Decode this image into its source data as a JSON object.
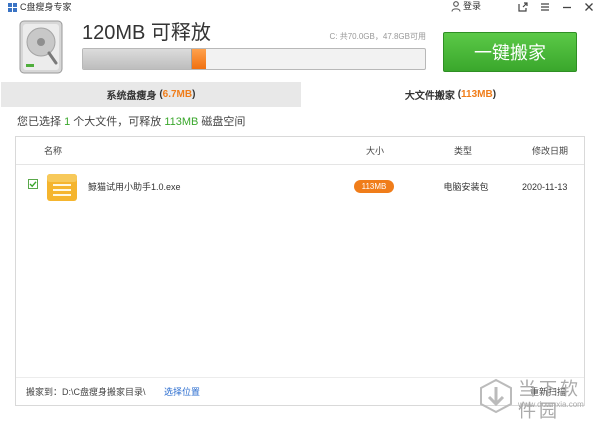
{
  "app": {
    "title": "C盘瘦身专家",
    "login": "登录"
  },
  "header": {
    "headline": "120MB 可释放",
    "disk_info": "C: 共70.0GB，47.8GB可用",
    "progress_used_fraction": 0.32,
    "progress_release_fraction": 0.04,
    "cta_label": "一键搬家"
  },
  "tabs": [
    {
      "label": "系统盘瘦身",
      "size": "6.7MB"
    },
    {
      "label": "大文件搬家",
      "size": "113MB"
    }
  ],
  "summary": {
    "prefix": "您已选择",
    "count": "1",
    "middle": "个大文件，可释放",
    "size": "113MB",
    "suffix": "磁盘空间"
  },
  "list": {
    "columns": {
      "name": "名称",
      "size": "大小",
      "type": "类型",
      "date": "修改日期"
    },
    "rows": [
      {
        "name": "鲸猫试用小助手1.0.exe",
        "size": "113MB",
        "type": "电脑安装包",
        "date": "2020-11-13",
        "checked": true
      }
    ]
  },
  "footer": {
    "move_label": "搬家到：",
    "move_path": "D:\\C盘瘦身搬家目录\\",
    "choose_link": "选择位置",
    "rescan": "重新扫描"
  },
  "watermark": {
    "name": "当下软件园",
    "url": "www.downxia.com"
  },
  "colors": {
    "accent_orange": "#f07d1a",
    "green": "#3aa72c",
    "link_blue": "#2a6ccf"
  }
}
